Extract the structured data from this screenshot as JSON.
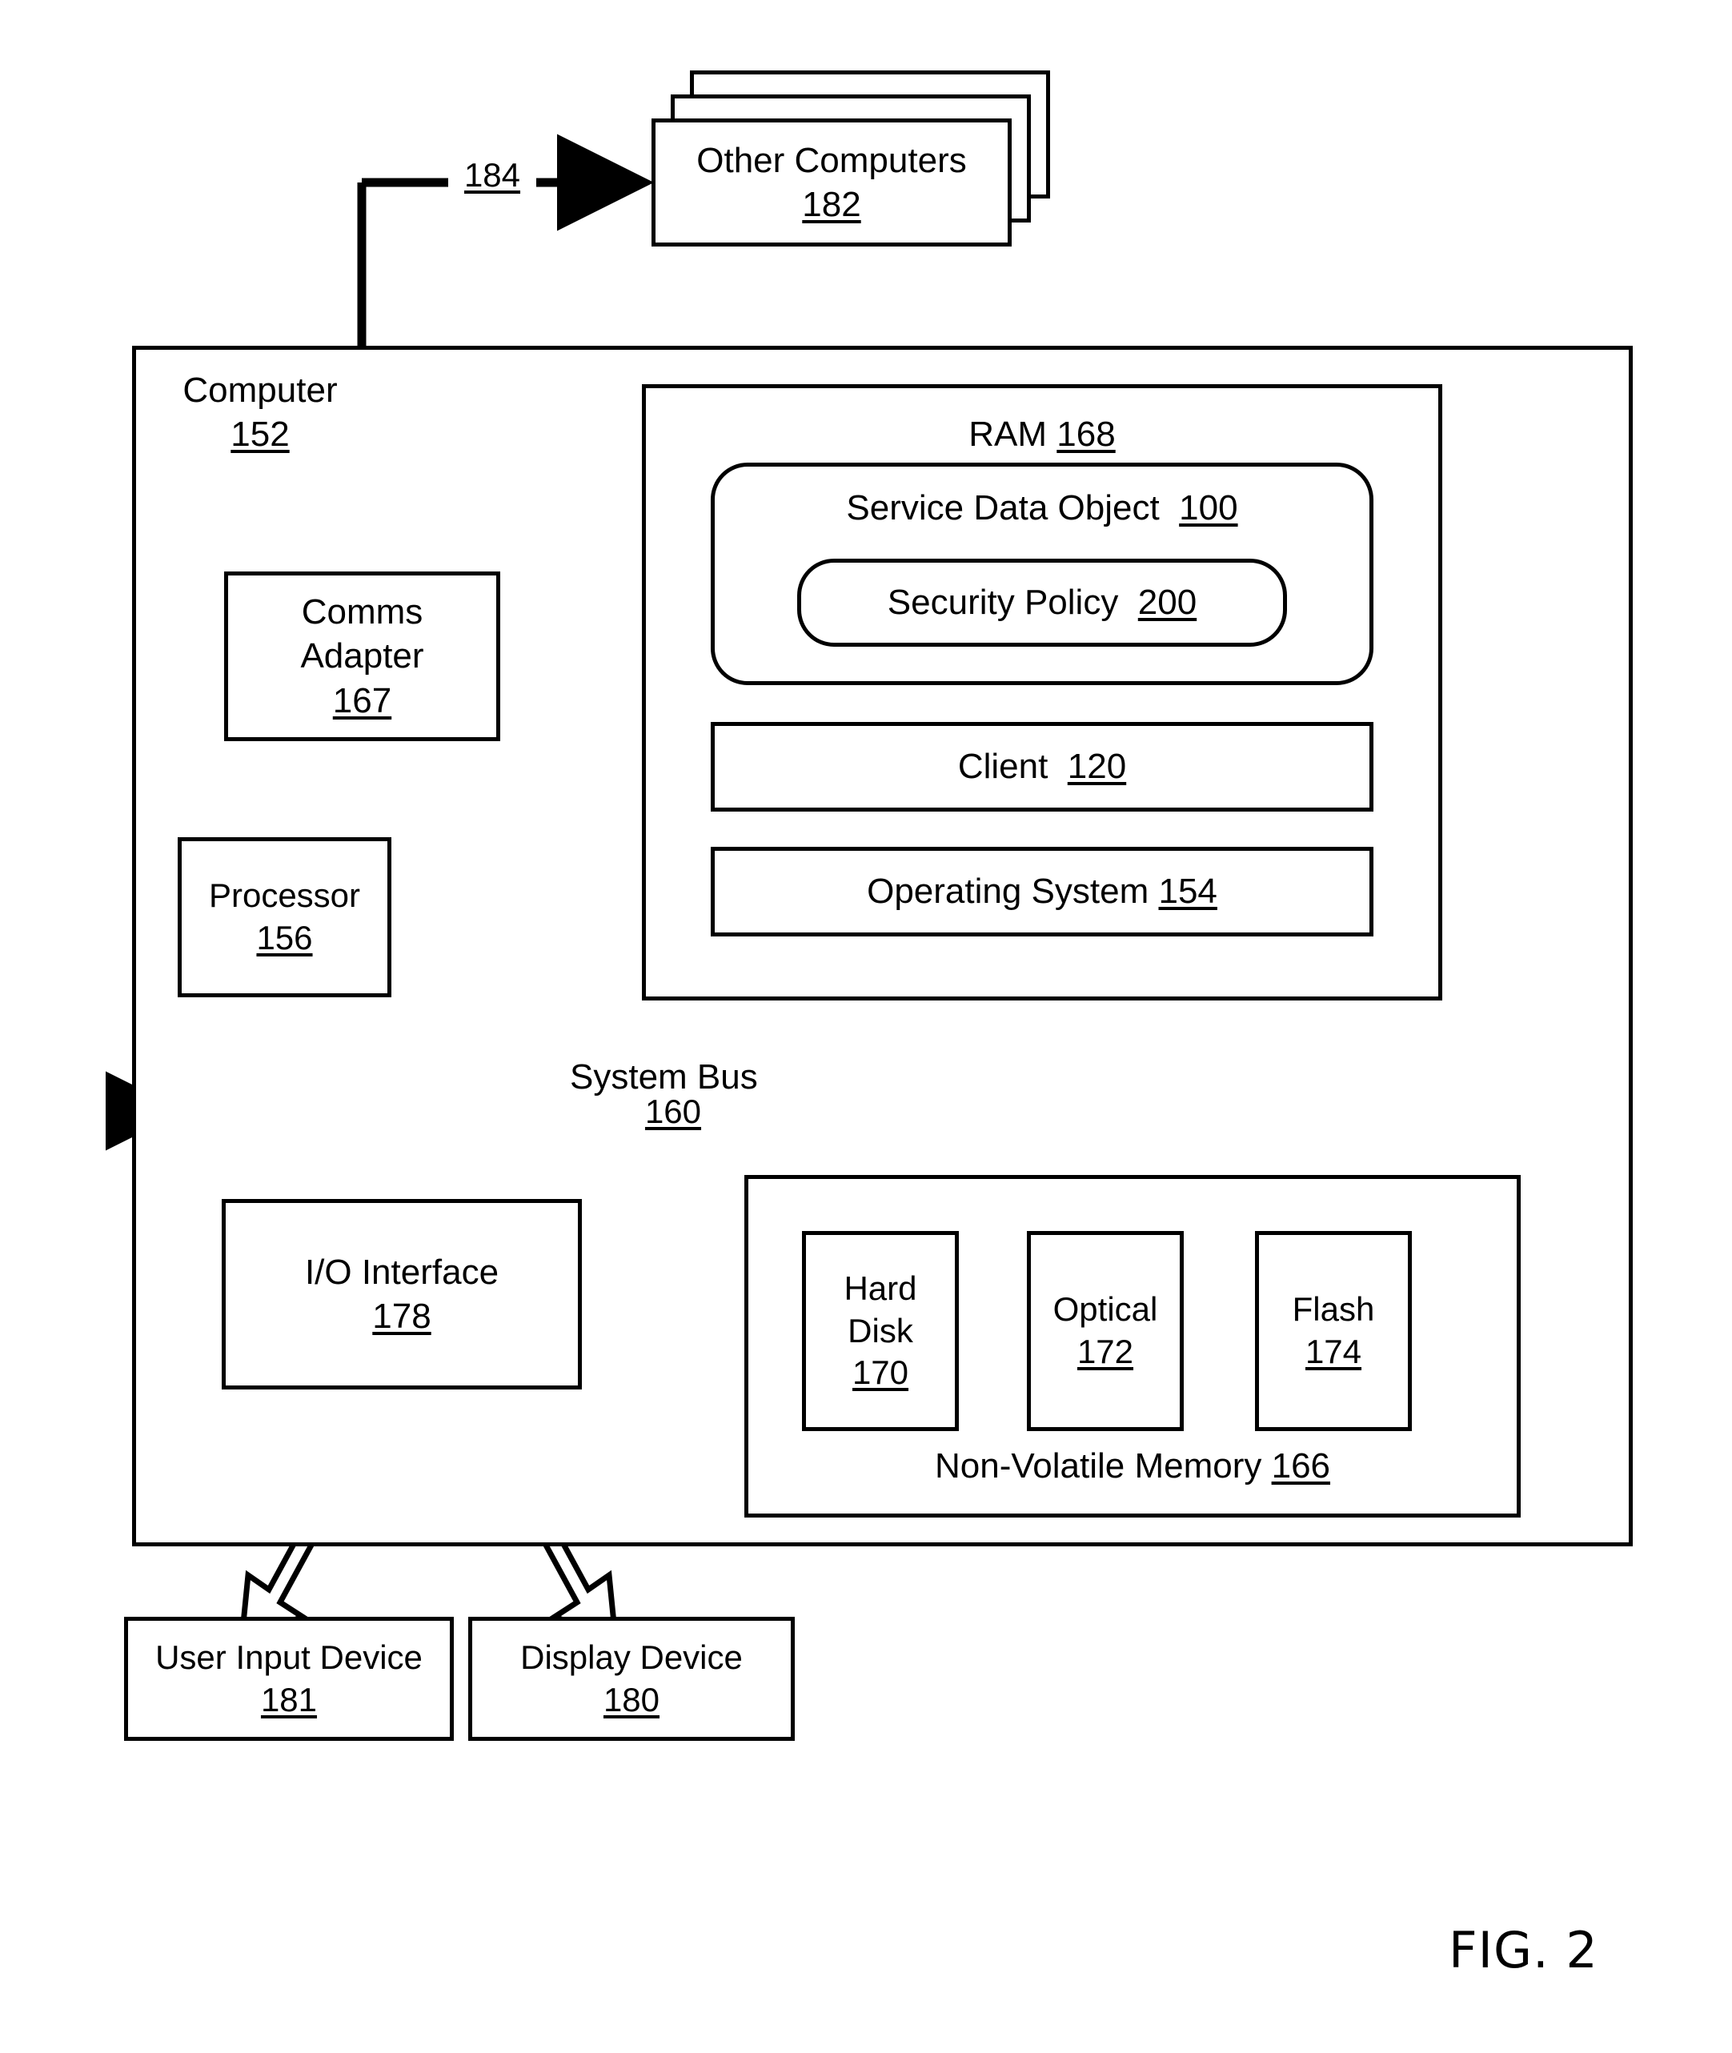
{
  "figure": {
    "caption": "FIG. 2",
    "type": "patent-block-diagram"
  },
  "network": {
    "connector_label": "184",
    "other_computers": {
      "title": "Other Computers",
      "ref": "182"
    }
  },
  "computer": {
    "title": "Computer",
    "ref": "152"
  },
  "comms_adapter": {
    "title": "Comms\nAdapter",
    "ref": "167"
  },
  "processor": {
    "title": "Processor",
    "ref": "156"
  },
  "ram": {
    "title": "RAM",
    "ref": "168",
    "service_data_object": {
      "title": "Service Data Object",
      "ref": "100",
      "security_policy": {
        "title": "Security Policy",
        "ref": "200"
      }
    },
    "client": {
      "title": "Client",
      "ref": "120"
    },
    "operating_system": {
      "title": "Operating System",
      "ref": "154"
    }
  },
  "system_bus": {
    "title": "System Bus",
    "ref": "160"
  },
  "io_interface": {
    "title": "I/O Interface",
    "ref": "178"
  },
  "user_input_device": {
    "title": "User Input Device",
    "ref": "181"
  },
  "display_device": {
    "title": "Display Device",
    "ref": "180"
  },
  "non_volatile_memory": {
    "title": "Non-Volatile Memory",
    "ref": "166",
    "devices": [
      {
        "title": "Hard\nDisk",
        "ref": "170"
      },
      {
        "title": "Optical",
        "ref": "172"
      },
      {
        "title": "Flash",
        "ref": "174"
      }
    ]
  },
  "colors": {
    "stroke": "#000000",
    "background": "#ffffff"
  }
}
